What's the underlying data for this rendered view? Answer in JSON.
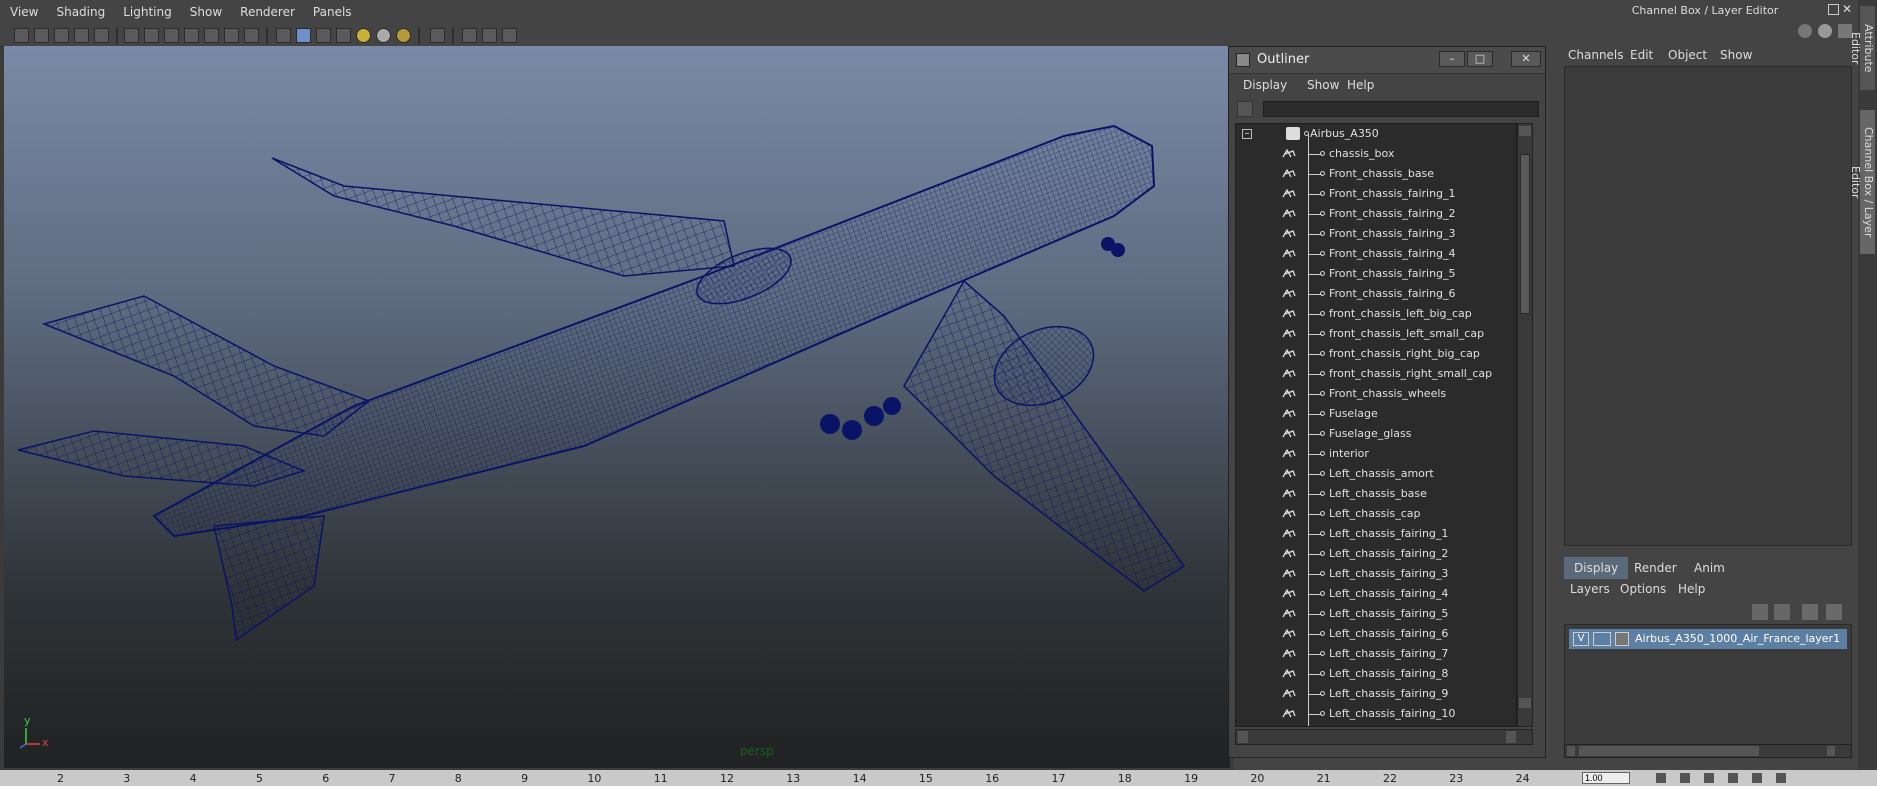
{
  "viewport": {
    "menu": [
      "View",
      "Shading",
      "Lighting",
      "Show",
      "Renderer",
      "Panels"
    ],
    "camera_label": "persp",
    "axis": {
      "y": "y",
      "x": "x"
    }
  },
  "outliner": {
    "title": "Outliner",
    "menu": [
      "Display",
      "Show",
      "Help"
    ],
    "root": "Airbus_A350",
    "items": [
      "chassis_box",
      "Front_chassis_base",
      "Front_chassis_fairing_1",
      "Front_chassis_fairing_2",
      "Front_chassis_fairing_3",
      "Front_chassis_fairing_4",
      "Front_chassis_fairing_5",
      "Front_chassis_fairing_6",
      "front_chassis_left_big_cap",
      "front_chassis_left_small_cap",
      "front_chassis_right_big_cap",
      "front_chassis_right_small_cap",
      "Front_chassis_wheels",
      "Fuselage",
      "Fuselage_glass",
      "interior",
      "Left_chassis_amort",
      "Left_chassis_base",
      "Left_chassis_cap",
      "Left_chassis_fairing_1",
      "Left_chassis_fairing_2",
      "Left_chassis_fairing_3",
      "Left_chassis_fairing_4",
      "Left_chassis_fairing_5",
      "Left_chassis_fairing_6",
      "Left_chassis_fairing_7",
      "Left_chassis_fairing_8",
      "Left_chassis_fairing_9",
      "Left_chassis_fairing_10"
    ]
  },
  "channel_box": {
    "title": "Channel Box / Layer Editor",
    "menu": [
      "Channels",
      "Edit",
      "Object",
      "Show"
    ],
    "tabs": [
      "Display",
      "Render",
      "Anim"
    ],
    "layers_menu": [
      "Layers",
      "Options",
      "Help"
    ],
    "layer": {
      "visible": "V",
      "name": "Airbus_A350_1000_Air_France_layer1"
    }
  },
  "side_tabs": [
    "Attribute Editor",
    "Channel Box / Layer Editor"
  ],
  "timeline": {
    "ticks": [
      "2",
      "3",
      "4",
      "5",
      "6",
      "7",
      "8",
      "9",
      "10",
      "11",
      "12",
      "13",
      "14",
      "15",
      "16",
      "17",
      "18",
      "19",
      "20",
      "21",
      "22",
      "23",
      "24"
    ],
    "current_time": "1.00"
  },
  "colors": {
    "wireframe": "#0f1a6e",
    "selected_layer": "#5c7fa3"
  }
}
